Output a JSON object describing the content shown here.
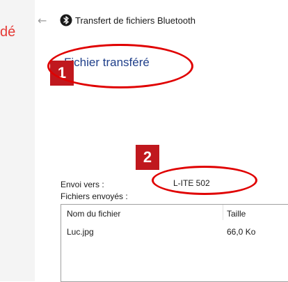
{
  "background": {
    "partial_text": "dé"
  },
  "window": {
    "back_icon": "back-arrow-icon",
    "app_icon": "bluetooth-icon",
    "title": "Transfert de fichiers Bluetooth",
    "heading": "Fichier transféré"
  },
  "details": {
    "send_to_label": "Envoi vers :",
    "send_to_value": "L-ITE 502",
    "sent_files_label": "Fichiers envoyés :"
  },
  "table": {
    "columns": [
      "Nom du fichier",
      "Taille"
    ],
    "rows": [
      [
        "Luc.jpg",
        "66,0 Ko"
      ]
    ]
  },
  "annotations": {
    "badge1": "1",
    "badge2": "2",
    "highlight_color": "#e00000",
    "badge_color": "#c0181e"
  },
  "colors": {
    "heading": "#1f3f8a",
    "bluetooth_icon_bg": "#1a1a1a"
  }
}
